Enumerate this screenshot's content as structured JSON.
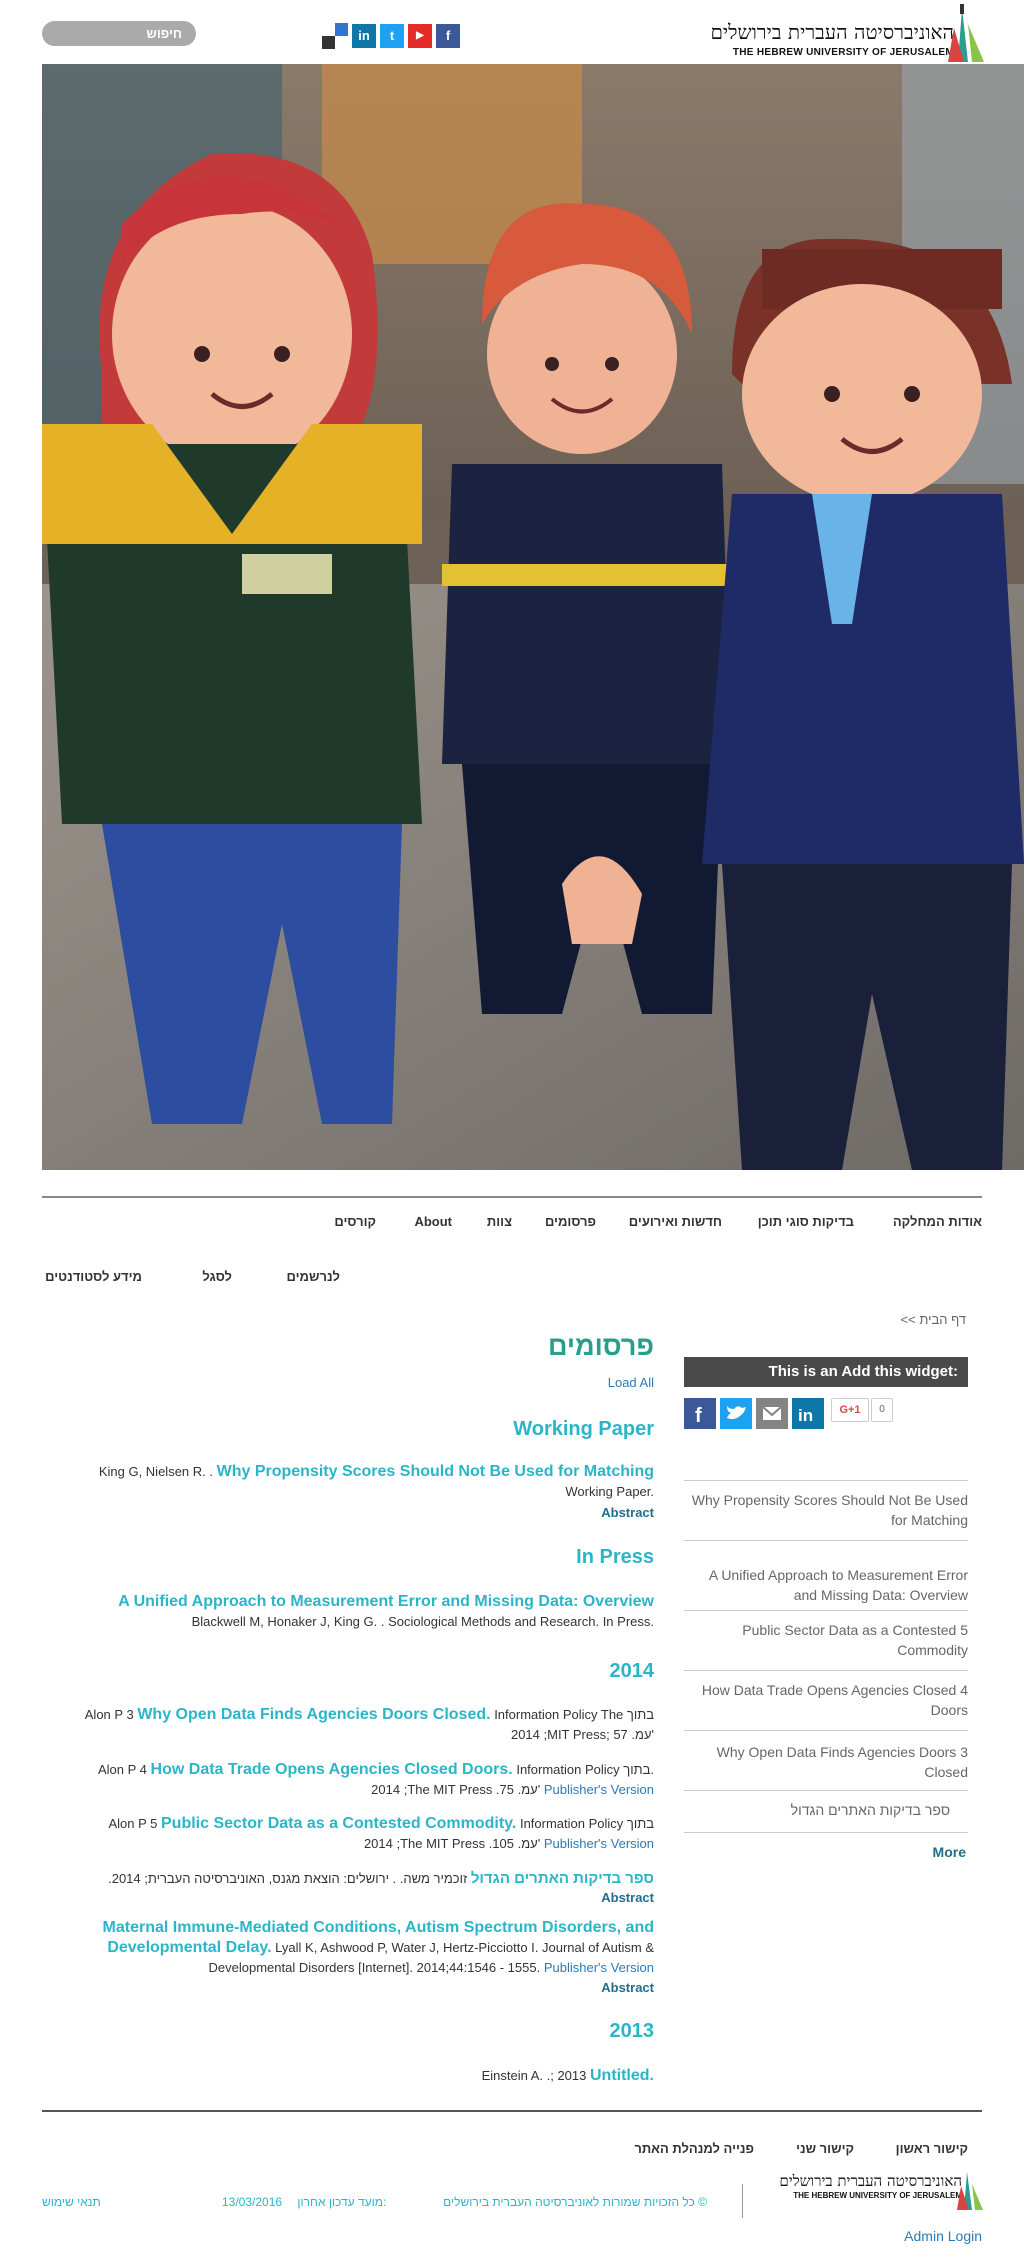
{
  "header": {
    "search_label": "חיפוש",
    "logo_hebrew": "האוניברסיטה העברית בירושלים",
    "logo_english": "THE HEBREW UNIVERSITY OF JERUSALEM",
    "social": [
      {
        "name": "facebook-icon",
        "glyph": "f",
        "color": "#3b5998"
      },
      {
        "name": "youtube-icon",
        "glyph": "▶",
        "color": "#e52d27"
      },
      {
        "name": "twitter-icon",
        "glyph": "t",
        "color": "#1da1f2"
      },
      {
        "name": "linkedin-icon",
        "glyph": "in",
        "color": "#0e76a8"
      },
      {
        "name": "delicious-icon",
        "glyph": "",
        "color": "#3274d1"
      }
    ]
  },
  "nav": {
    "primary": [
      "אודות המחלקה",
      "בדיקות סוגי תוכן",
      "חדשות ואירועים",
      "פרסומים",
      "צוות",
      "About",
      "קורסים"
    ],
    "secondary": [
      "לנרשמים",
      "לסגל",
      "מידע לסטודנטים"
    ]
  },
  "breadcrumb": "דף הבית >>",
  "sidebar": {
    "widget_title": "This is an Add this widget:",
    "gplus_label": "G+1",
    "gplus_count": "0",
    "items": [
      "Why Propensity Scores Should Not Be Used for Matching",
      "A Unified Approach to Measurement Error and Missing Data: Overview",
      "5 Public Sector Data as a Contested Commodity",
      "4 How Data Trade Opens Agencies Closed Doors",
      "3 Why Open Data Finds Agencies Doors Closed",
      "ספר בדיקות האתרים הגדול"
    ],
    "more": "More"
  },
  "main": {
    "title": "פרסומים",
    "load_all": "Load All",
    "working_paper": {
      "heading": "Working Paper",
      "entry_title": "Why Propensity Scores Should Not Be Used for Matching",
      "authors": "King G, Nielsen R. .",
      "line2": "Working Paper.",
      "abstract": "Abstract"
    },
    "in_press": {
      "heading": "In Press",
      "entry_title": "A Unified Approach to Measurement Error and Missing Data: Overview",
      "line2": "Blackwell M, Honaker J, King G. . Sociological Methods and Research. In Press."
    },
    "y2014": {
      "heading": "2014",
      "e3_title": "Why Open Data Finds Agencies Doors Closed.",
      "e3_prefix": "Information Policy The  בתוך",
      "e3_suffix": "Alon P 3",
      "e3_line2": "2014 ;MIT Press; 57 .עמ'",
      "e4_title": "How Data Trade Opens Agencies Closed Doors.",
      "e4_prefix": "Information Policy  בתוך.",
      "e4_suffix": "Alon P 4",
      "e4_line2": "2014 ;The MIT Press .75 .עמ'",
      "e5_title": "Public Sector Data as a Contested Commodity.",
      "e5_prefix": "Information Policy  בתוך",
      "e5_suffix": "Alon P 5",
      "e5_line2": "2014 ;The MIT Press .105 .עמ'",
      "pub_version": "Publisher's Version",
      "book_title": "ספר בדיקות האתרים הגדול",
      "book_rest": "זוכמיר משה. . ירושלים: הוצאת מגנס, האוניברסיטה העברית; 2014.",
      "book_abstract": "Abstract",
      "m_title": "Maternal Immune-Mediated Conditions, Autism Spectrum Disorders, and Developmental Delay.",
      "m_rest1": "Lyall K, Ashwood P, Water J, Hertz-Picciotto I. Journal of Autism &",
      "m_rest2": "Developmental Disorders [Internet]. 2014;44:1546 - 1555.",
      "m_abstract": "Abstract"
    },
    "y2013": {
      "heading": "2013",
      "title": "Untitled.",
      "rest": "Einstein A. .; 2013"
    }
  },
  "footer": {
    "links": [
      "קישור ראשון",
      "קישור שני",
      "פנייה למנהלת האתר"
    ],
    "logo_hebrew": "האוניברסיטה העברית בירושלים",
    "logo_english": "THE HEBREW UNIVERSITY OF JERUSALEM",
    "copyright": "© כל הזכויות שמורות לאוניברסיטה העברית בירושלים",
    "updated_label": "מועד עדכון אחרון:",
    "updated_date": "13/03/2016",
    "terms": "תנאי שימוש",
    "admin_login": "Admin Login"
  }
}
